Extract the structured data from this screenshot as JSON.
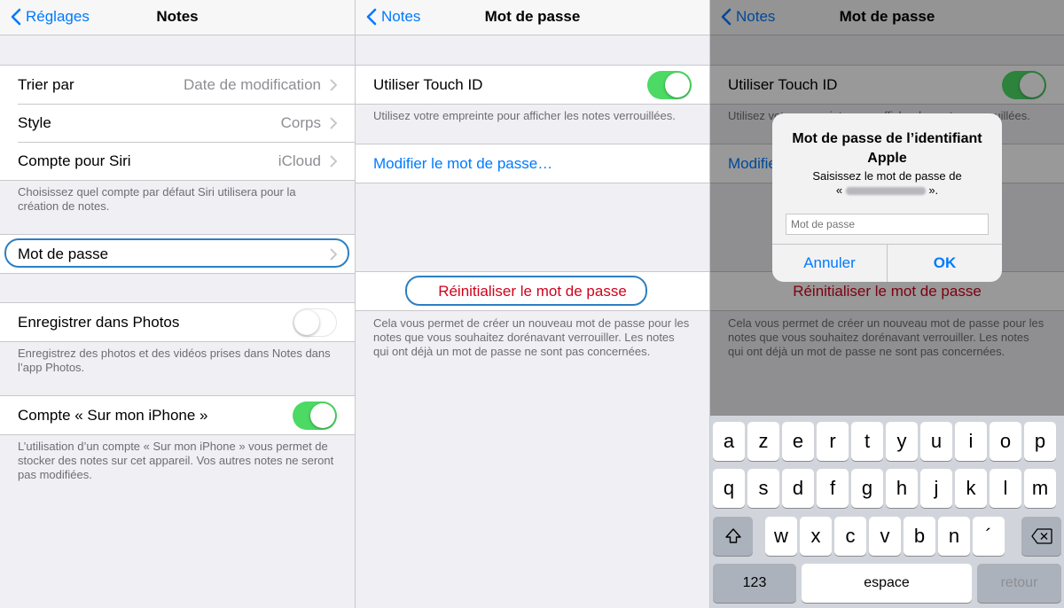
{
  "panel1": {
    "nav": {
      "back": "Réglages",
      "title": "Notes"
    },
    "group1": [
      {
        "label": "Trier par",
        "value": "Date de modification"
      },
      {
        "label": "Style",
        "value": "Corps"
      },
      {
        "label": "Compte pour Siri",
        "value": "iCloud"
      }
    ],
    "footer1": "Choisissez quel compte par défaut Siri utilisera pour la création de notes.",
    "password": {
      "label": "Mot de passe"
    },
    "photos": {
      "label": "Enregistrer dans Photos",
      "toggle": "off"
    },
    "footer2": "Enregistrez des photos et des vidéos prises dans Notes dans l’app Photos.",
    "onmyiphone": {
      "label": "Compte « Sur mon iPhone »",
      "toggle": "on"
    },
    "footer3": "L’utilisation d’un compte « Sur mon iPhone » vous permet de stocker des notes sur cet appareil. Vos autres notes ne seront pas modifiées."
  },
  "panel2": {
    "nav": {
      "back": "Notes",
      "title": "Mot de passe"
    },
    "touchid": {
      "label": "Utiliser Touch ID",
      "toggle": "on"
    },
    "touchid_footer": "Utilisez votre empreinte pour afficher les notes verrouillées.",
    "change": "Modifier le mot de passe…",
    "reset": "Réinitialiser le mot de passe",
    "reset_footer": "Cela vous permet de créer un nouveau mot de passe pour les notes que vous souhaitez dorénavant verrouiller. Les notes qui ont déjà un mot de passe ne sont pas concernées."
  },
  "panel3": {
    "nav": {
      "back": "Notes",
      "title": "Mot de passe"
    },
    "touchid": {
      "label": "Utiliser Touch ID",
      "toggle": "on"
    },
    "touchid_footer": "Utilisez votre empreinte pour afficher les notes verrouillées.",
    "change": "Modifier le mot de passe…",
    "reset": "Réinitialiser le mot de passe",
    "reset_footer": "Cela vous permet de créer un nouveau mot de passe pour les notes que vous souhaitez dorénavant verrouiller. Les notes qui ont déjà un mot de passe ne sont pas concernées.",
    "alert": {
      "title": "Mot de passe de l’identifiant Apple",
      "message_prefix": "Saisissez le mot de passe de",
      "quote_open": "«",
      "quote_close": "».",
      "placeholder": "Mot de passe",
      "cancel": "Annuler",
      "ok": "OK"
    },
    "keyboard": {
      "row1": [
        "a",
        "z",
        "e",
        "r",
        "t",
        "y",
        "u",
        "i",
        "o",
        "p"
      ],
      "row2": [
        "q",
        "s",
        "d",
        "f",
        "g",
        "h",
        "j",
        "k",
        "l",
        "m"
      ],
      "row3": [
        "w",
        "x",
        "c",
        "v",
        "b",
        "n",
        "´"
      ],
      "numbers": "123",
      "space": "espace",
      "return": "retour"
    }
  },
  "colors": {
    "accent": "#007aff",
    "toggle_on": "#4cd964",
    "destructive": "#d0021b",
    "highlight": "#2d7fc1"
  }
}
